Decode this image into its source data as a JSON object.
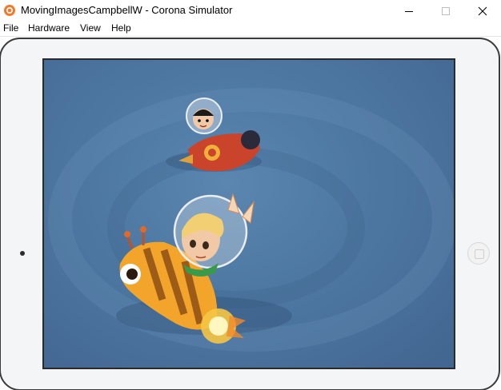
{
  "window": {
    "title": "MovingImagesCampbellW - Corona Simulator",
    "icon": "corona-app-icon",
    "controls": {
      "minimize": "minimize-icon",
      "maximize": "maximize-icon",
      "close": "close-icon"
    }
  },
  "menubar": {
    "items": [
      {
        "label": "File"
      },
      {
        "label": "Hardware"
      },
      {
        "label": "View"
      },
      {
        "label": "Help"
      }
    ]
  },
  "device": {
    "type": "tablet-landscape",
    "frame_color": "#f4f5f7",
    "screen_background": "#4d77a1",
    "images": [
      {
        "name": "astronaut-boy-rocket",
        "description_icon": "red-rocket-sprite"
      },
      {
        "name": "astronaut-girl-bee-rocket",
        "description_icon": "yellow-bee-rocket-sprite"
      }
    ]
  }
}
